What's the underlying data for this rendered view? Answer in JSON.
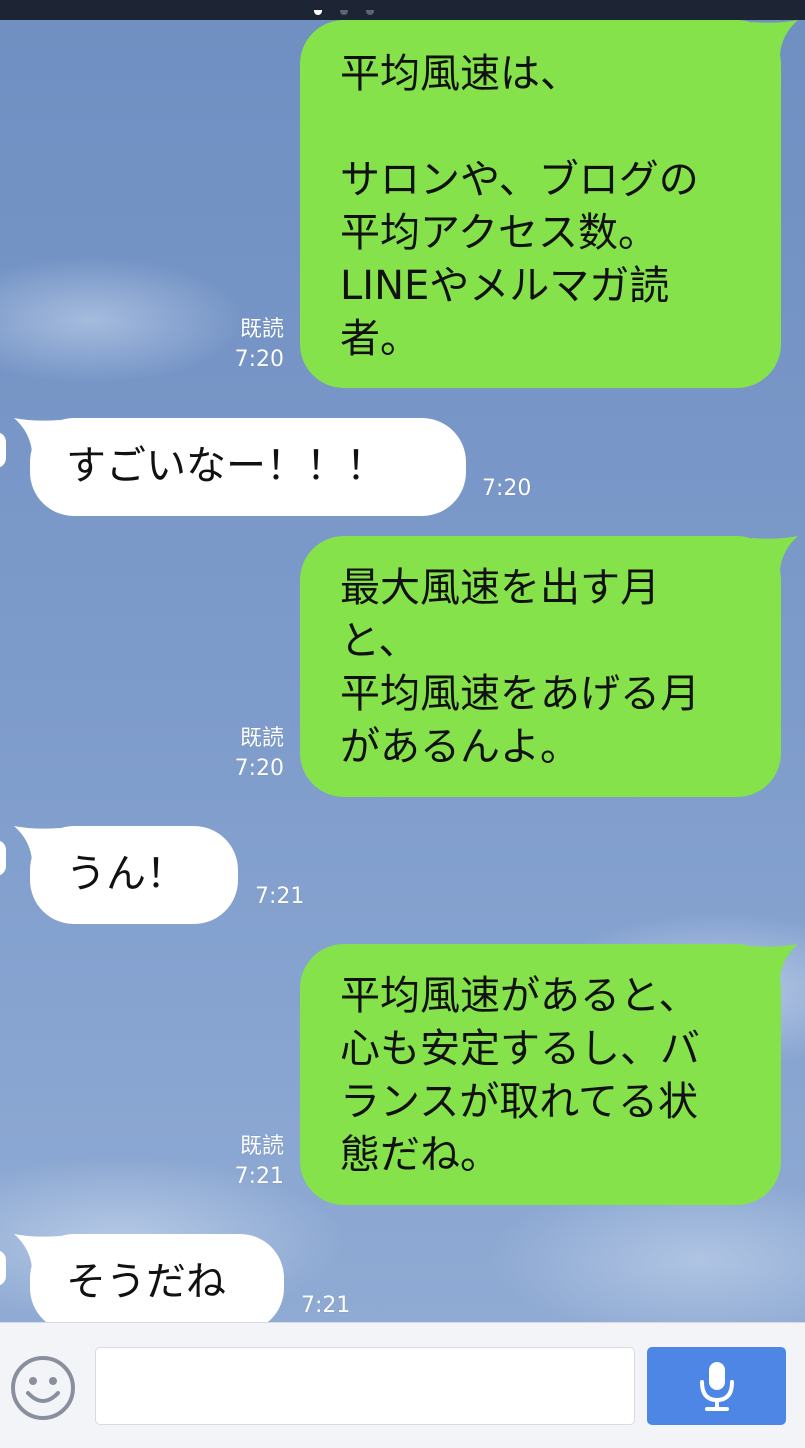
{
  "status_bar": {
    "dots": 3
  },
  "messages": [
    {
      "side": "sent",
      "text": "平均風速は、\n\nサロンや、ブログの\n平均アクセス数。\nLINEやメルマガ読\n者。",
      "read": "既読",
      "time": "7:20"
    },
    {
      "side": "recv",
      "text": "すごいなー！！！",
      "time": "7:20"
    },
    {
      "side": "sent",
      "text": "最大風速を出す月\nと、\n平均風速をあげる月\nがあるんよ。",
      "read": "既読",
      "time": "7:20"
    },
    {
      "side": "recv",
      "text": "うん！",
      "time": "7:21"
    },
    {
      "side": "sent",
      "text": "平均風速があると、\n心も安定するし、バ\nランスが取れてる状\n態だね。",
      "read": "既読",
      "time": "7:21"
    },
    {
      "side": "recv",
      "text": "そうだね",
      "time": "7:21"
    }
  ],
  "input_bar": {
    "emoji_icon": "smiley-icon",
    "input_value": "",
    "input_placeholder": "",
    "mic_icon": "microphone-icon"
  },
  "colors": {
    "sent_bubble": "#85e24b",
    "received_bubble": "#ffffff",
    "mic_button": "#4e86e6",
    "status_bar": "#1d2535"
  }
}
